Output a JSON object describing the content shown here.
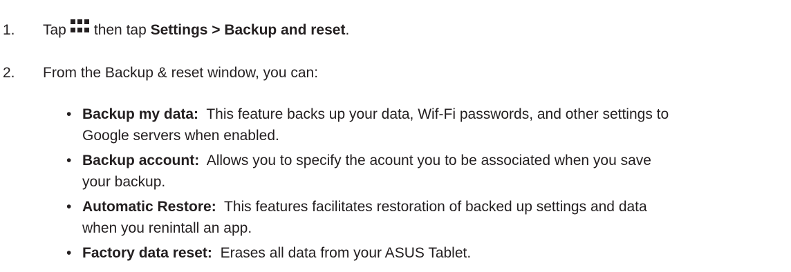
{
  "steps": [
    {
      "number": "1.",
      "prefix": "Tap",
      "icon": "apps-grid-icon",
      "middle": "then tap",
      "path": "Settings > Backup and reset",
      "suffix": "."
    },
    {
      "number": "2.",
      "text": "From the Backup & reset window, you can:"
    }
  ],
  "bullets": [
    {
      "marker": "•",
      "term": "Backup my data:",
      "line1": "This feature backs up your data, Wif-Fi passwords, and other settings to",
      "line2": "Google servers when enabled."
    },
    {
      "marker": "•",
      "term": "Backup account:",
      "line1": "Allows you to specify the acount you to be associated when you save",
      "line2": "your backup."
    },
    {
      "marker": "•",
      "term": "Automatic Restore:",
      "line1": "This features facilitates restoration of backed up settings and data",
      "line2": "when you renintall an app."
    },
    {
      "marker": "•",
      "term": "Factory data reset:",
      "line1": "Erases all data from your ASUS Tablet.",
      "line2": ""
    }
  ]
}
